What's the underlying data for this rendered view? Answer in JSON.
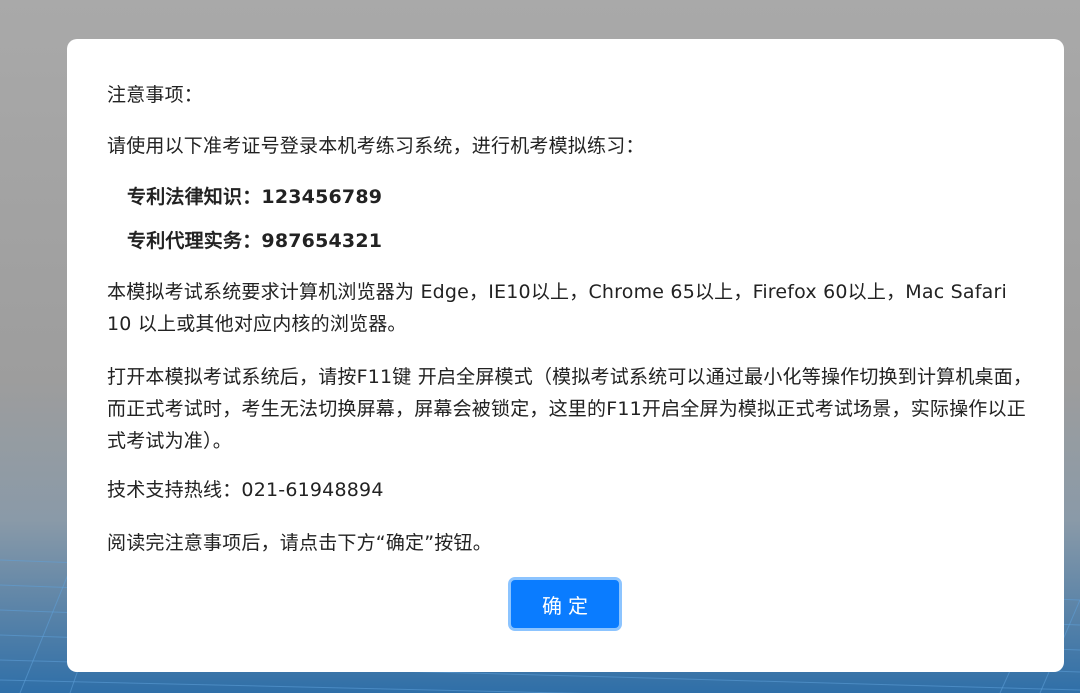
{
  "notice": {
    "title": "注意事项：",
    "intro": "请使用以下准考证号登录本机考练习系统，进行机考模拟练习：",
    "accounts": [
      {
        "label": "专利法律知识：",
        "number": "123456789"
      },
      {
        "label": "专利代理实务：",
        "number": "987654321"
      }
    ],
    "browser_requirement": "本模拟考试系统要求计算机浏览器为 Edge，IE10以上，Chrome 65以上，Firefox 60以上，Mac Safari 10 以上或其他对应内核的浏览器。",
    "fullscreen_note": "打开本模拟考试系统后，请按F11键 开启全屏模式（模拟考试系统可以通过最小化等操作切换到计算机桌面，而正式考试时，考生无法切换屏幕，屏幕会被锁定，这里的F11开启全屏为模拟正式考试场景，实际操作以正式考试为准）。",
    "hotline": "技术支持热线：021-61948894",
    "read_instruction": "阅读完注意事项后，请点击下方“确定”按钮。",
    "confirm_label": "确定"
  },
  "colors": {
    "button": "#0a7cff",
    "button_border": "#8cc4ff",
    "overlay": "#a9a9a9",
    "dialog": "#ffffff"
  }
}
